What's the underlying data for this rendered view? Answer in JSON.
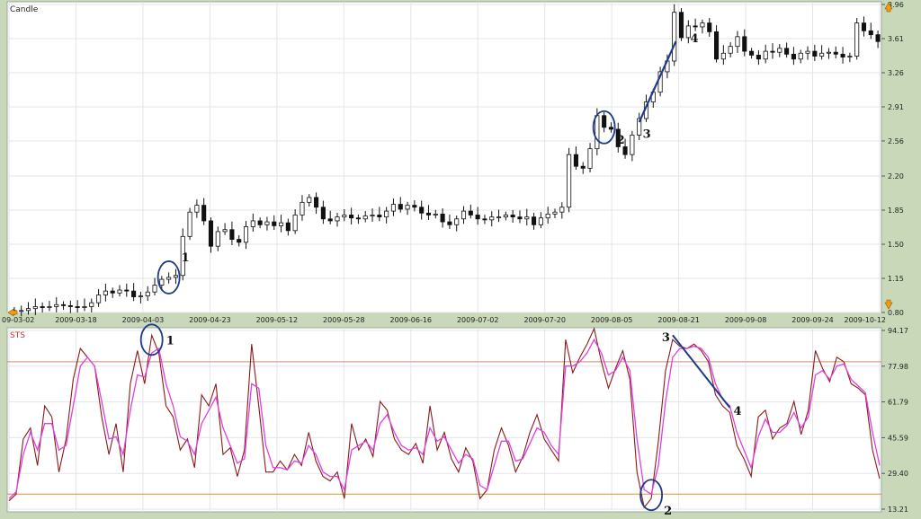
{
  "colors": {
    "panel_bg": "#ffffff",
    "frame_bg": "#c8d8b8",
    "grid": "#e2e6ea",
    "candle_edge": "#111111",
    "candle_up_fill": "#ffffff",
    "candle_down_fill": "#111111",
    "sts_main": "#8b1a1a",
    "sts_signal": "#e040e0",
    "level_high": "#d08a6a",
    "level_low": "#e0902a",
    "annotation": "#1e3a8a",
    "marker": "#f39c12"
  },
  "chart_data": [
    {
      "type": "candlestick",
      "title": "Candle",
      "x_tick_labels": [
        "09-03-02",
        "2009-03-18",
        "2009-04-03",
        "2009-04-23",
        "2009-05-12",
        "2009-05-28",
        "2009-06-16",
        "2009-07-02",
        "2009-07-20",
        "2009-08-05",
        "2009-08-21",
        "2009-09-08",
        "2009-09-24",
        "2009-10-12"
      ],
      "y_tick_labels": [
        "3.96",
        "3.61",
        "3.26",
        "2.91",
        "2.56",
        "2.20",
        "1.85",
        "1.50",
        "1.15",
        "0.80"
      ],
      "ylim": [
        0.8,
        3.96
      ],
      "grid": true,
      "annotations": [
        {
          "label": "1",
          "text": "1",
          "bar": 22,
          "kind": "circle"
        },
        {
          "label": "2",
          "text": "2",
          "bar": 84,
          "kind": "circle"
        },
        {
          "label": "3",
          "text": "3",
          "bar": 89,
          "kind": "trendline-start"
        },
        {
          "label": "4",
          "text": "4",
          "bar": 95,
          "kind": "trendline-end"
        }
      ],
      "closes": [
        0.82,
        0.82,
        0.84,
        0.86,
        0.85,
        0.86,
        0.88,
        0.87,
        0.86,
        0.85,
        0.86,
        0.9,
        0.98,
        1.02,
        1.0,
        1.03,
        1.02,
        0.96,
        0.97,
        1.01,
        1.08,
        1.14,
        1.16,
        1.18,
        1.58,
        1.83,
        1.9,
        1.74,
        1.48,
        1.63,
        1.65,
        1.55,
        1.52,
        1.68,
        1.74,
        1.7,
        1.73,
        1.69,
        1.72,
        1.64,
        1.8,
        1.93,
        1.98,
        1.88,
        1.76,
        1.74,
        1.78,
        1.8,
        1.77,
        1.76,
        1.79,
        1.8,
        1.78,
        1.84,
        1.91,
        1.86,
        1.9,
        1.88,
        1.82,
        1.8,
        1.81,
        1.73,
        1.7,
        1.76,
        1.84,
        1.8,
        1.76,
        1.75,
        1.78,
        1.78,
        1.8,
        1.78,
        1.76,
        1.78,
        1.7,
        1.77,
        1.81,
        1.83,
        1.88,
        2.42,
        2.3,
        2.28,
        2.48,
        2.82,
        2.7,
        2.68,
        2.5,
        2.42,
        2.62,
        2.79,
        2.96,
        3.06,
        3.27,
        3.38,
        3.88,
        3.62,
        3.74,
        3.73,
        3.77,
        3.68,
        3.4,
        3.46,
        3.53,
        3.63,
        3.48,
        3.44,
        3.4,
        3.48,
        3.47,
        3.51,
        3.45,
        3.4,
        3.46,
        3.48,
        3.43,
        3.46,
        3.47,
        3.45,
        3.42,
        3.43,
        3.77,
        3.69,
        3.65,
        3.58
      ]
    },
    {
      "type": "line",
      "title": "STS",
      "y_tick_labels": [
        "94.17",
        "77.98",
        "61.79",
        "45.59",
        "29.40",
        "13.21"
      ],
      "ylim": [
        13.21,
        94.17
      ],
      "levels": [
        80,
        20
      ],
      "series": [
        {
          "values": [
            17,
            20,
            45,
            50,
            33,
            60,
            55,
            30,
            45,
            72,
            86,
            82,
            78,
            55,
            38,
            52,
            30,
            70,
            85,
            70,
            92,
            84,
            60,
            55,
            40,
            45,
            32,
            65,
            60,
            70,
            38,
            41,
            28,
            40,
            88,
            60,
            30,
            30,
            35,
            31,
            38,
            33,
            48,
            35,
            28,
            26,
            30,
            18,
            52,
            40,
            45,
            37,
            62,
            58,
            45,
            40,
            38,
            43,
            34,
            60,
            40,
            48,
            36,
            30,
            41,
            35,
            18,
            22,
            40,
            50,
            42,
            30,
            37,
            48,
            56,
            45,
            40,
            35,
            90,
            75,
            82,
            88,
            95,
            80,
            68,
            77,
            85,
            72,
            30,
            14,
            18,
            44,
            76,
            90,
            87,
            86,
            88,
            85,
            80,
            65,
            60,
            57,
            42,
            36,
            28,
            55,
            58,
            45,
            50,
            52,
            62,
            47,
            58,
            85,
            77,
            71,
            82,
            80,
            70,
            68,
            65,
            40,
            27
          ]
        },
        {
          "values": [
            18,
            21,
            38,
            48,
            40,
            52,
            52,
            40,
            42,
            60,
            78,
            82,
            78,
            62,
            45,
            46,
            38,
            58,
            74,
            73,
            84,
            86,
            70,
            60,
            46,
            44,
            38,
            52,
            58,
            64,
            50,
            42,
            34,
            36,
            70,
            68,
            42,
            32,
            32,
            31,
            35,
            34,
            42,
            38,
            30,
            28,
            28,
            22,
            40,
            42,
            44,
            40,
            52,
            56,
            48,
            42,
            40,
            41,
            38,
            50,
            44,
            46,
            40,
            34,
            38,
            36,
            24,
            22,
            33,
            44,
            44,
            35,
            36,
            43,
            50,
            48,
            42,
            38,
            78,
            78,
            80,
            84,
            90,
            84,
            74,
            76,
            82,
            76,
            45,
            22,
            20,
            33,
            62,
            82,
            86,
            86,
            87,
            86,
            82,
            70,
            63,
            60,
            48,
            40,
            32,
            46,
            54,
            48,
            48,
            51,
            57,
            50,
            55,
            74,
            76,
            72,
            78,
            79,
            72,
            69,
            66,
            48,
            33
          ]
        }
      ],
      "annotations": [
        {
          "label": "1",
          "text": "1",
          "bar": 20,
          "kind": "circle"
        },
        {
          "label": "2",
          "text": "2",
          "bar": 90,
          "kind": "circle"
        },
        {
          "label": "3",
          "text": "3",
          "bar": 93,
          "kind": "trendline-start"
        },
        {
          "label": "4",
          "text": "4",
          "bar": 100,
          "kind": "trendline-end"
        }
      ]
    }
  ]
}
